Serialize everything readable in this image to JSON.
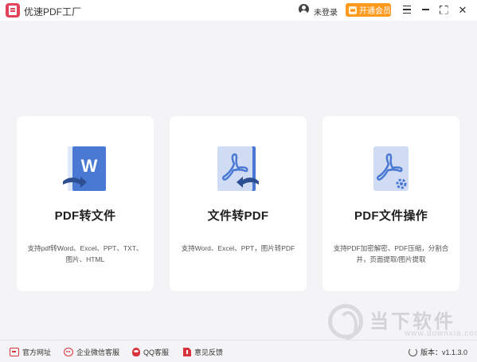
{
  "app": {
    "title": "优速PDF工厂"
  },
  "header": {
    "user_icon": "user-icon",
    "login_label": "未登录",
    "vip_label": "开通会员",
    "vip_color": "#ff9a1f",
    "controls": [
      "menu-icon",
      "minimize-icon",
      "maximize-icon",
      "close-icon"
    ]
  },
  "cards": [
    {
      "title": "PDF转文件",
      "description": "支持pdf转Word、Excel、PPT、TXT、图片、HTML",
      "icon": "word-document-icon"
    },
    {
      "title": "文件转PDF",
      "description": "支持Word、Excel、PPT，图片转PDF",
      "icon": "pdf-document-icon"
    },
    {
      "title": "PDF文件操作",
      "description": "支持PDF加密解密、PDF压缩，分割合并，页面提取/图片提取",
      "icon": "pdf-settings-icon"
    }
  ],
  "footer": {
    "links": [
      {
        "label": "官方网址",
        "icon": "website-icon"
      },
      {
        "label": "企业微信客服",
        "icon": "wechat-icon"
      },
      {
        "label": "QQ客服",
        "icon": "qq-icon"
      },
      {
        "label": "意见反馈",
        "icon": "feedback-icon"
      }
    ],
    "version_label": "版本：v1.1.3.0",
    "accent_color": "#d9343c"
  },
  "watermark": {
    "title": "当下软件园",
    "url": "www.downxia.com"
  },
  "colors": {
    "blue_primary": "#4a79d4",
    "blue_light": "#dfe8f8",
    "background": "#f4f4f6"
  }
}
